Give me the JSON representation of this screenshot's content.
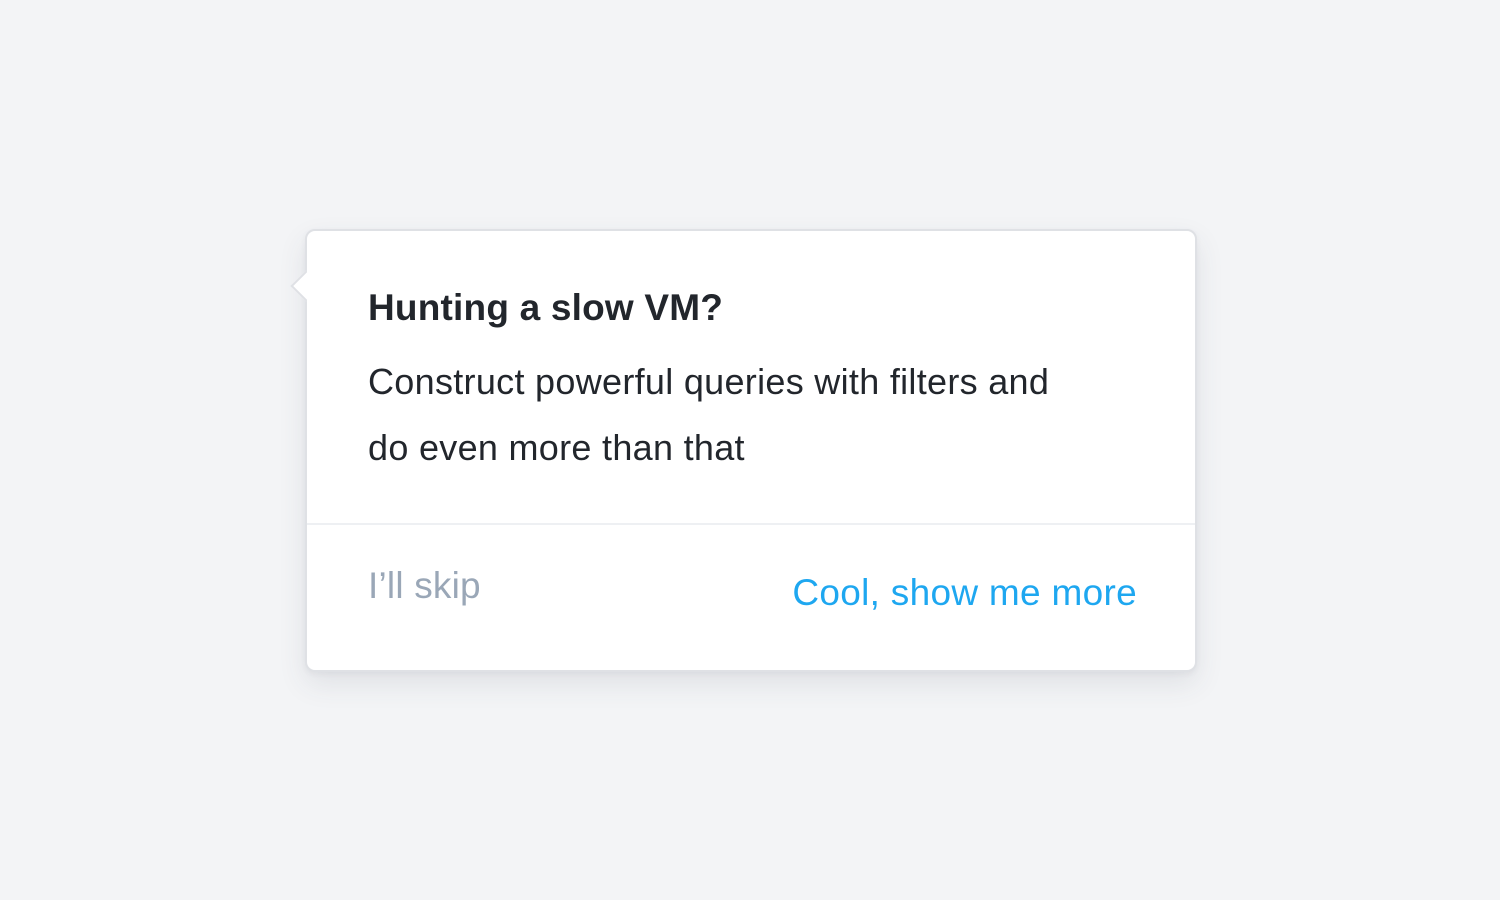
{
  "popover": {
    "title": "Hunting a slow VM?",
    "description_line1": "Construct powerful queries with filters and",
    "description_line2": "do even more than that",
    "skip_label": "I’ll skip",
    "more_label": "Cool, show me more"
  },
  "colors": {
    "background": "#f3f4f6",
    "card": "#ffffff",
    "text": "#22262c",
    "muted": "#9aa7b7",
    "accent": "#1ea7f0"
  }
}
